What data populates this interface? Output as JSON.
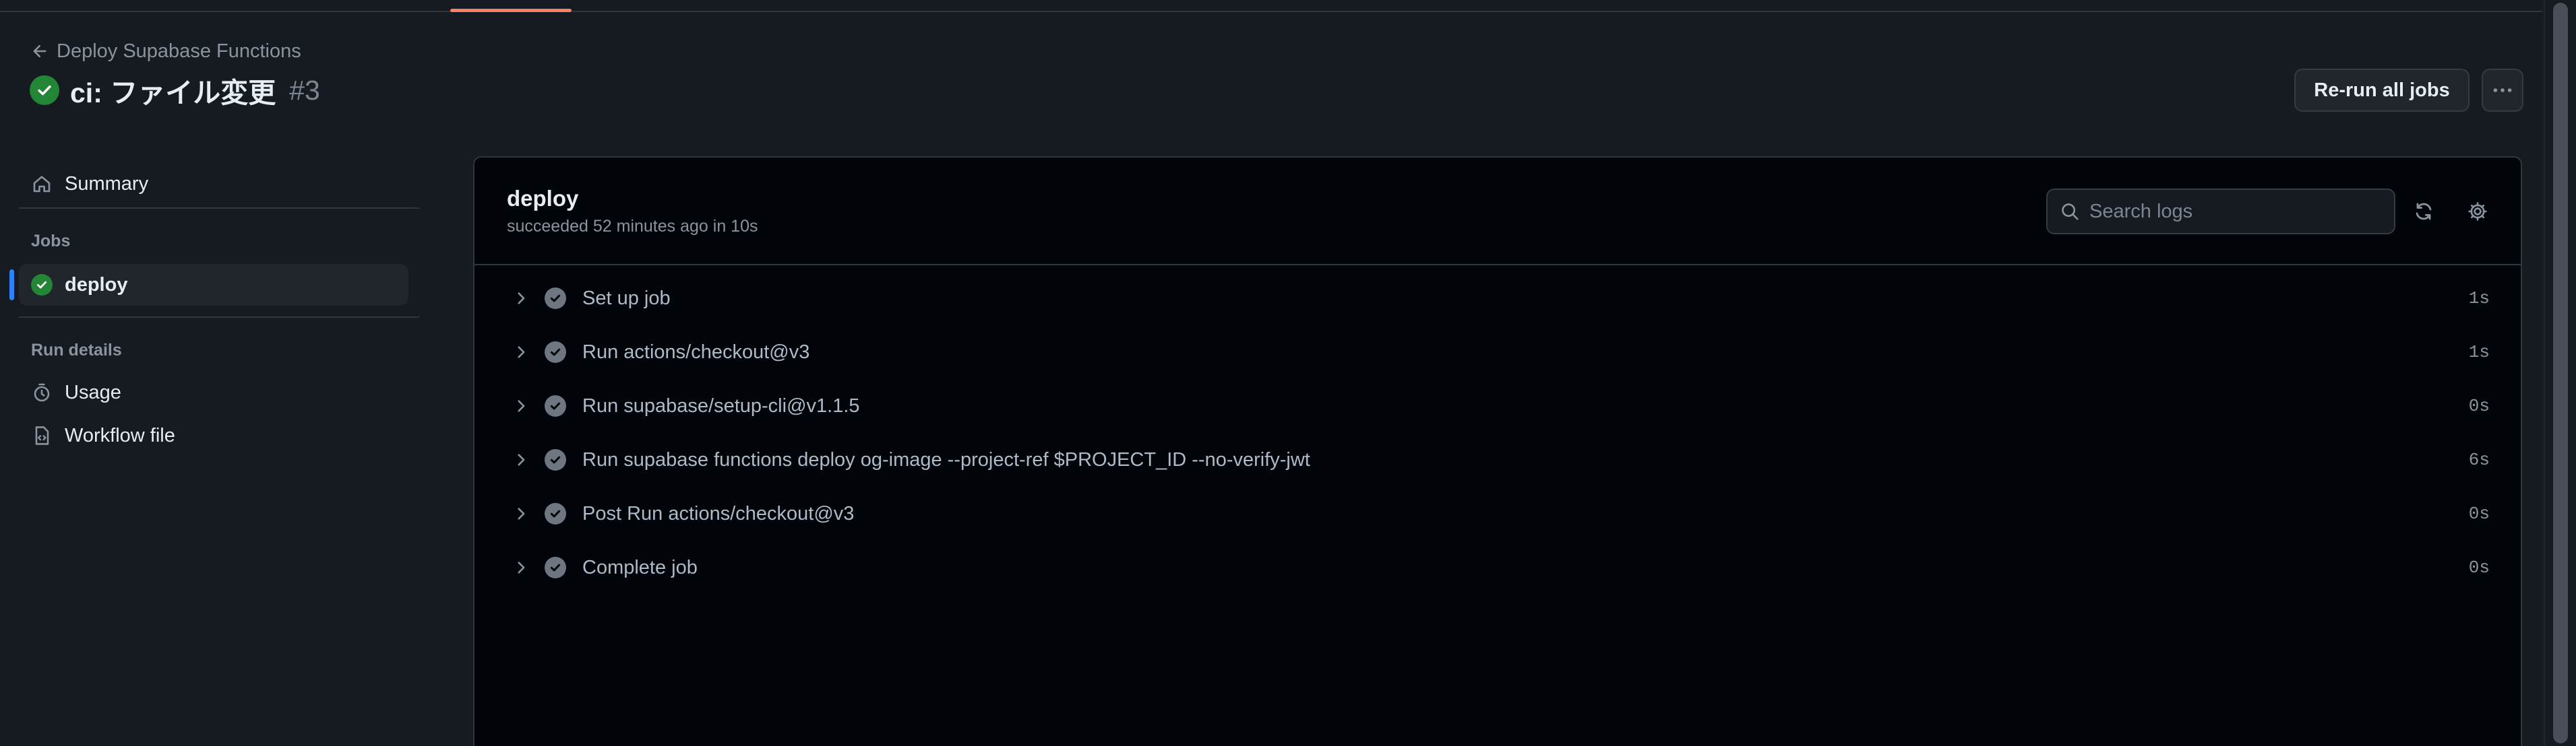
{
  "header": {
    "back_link": "Deploy Supabase Functions",
    "run_title": "ci: ファイル変更",
    "run_number": "#3",
    "rerun_button": "Re-run all jobs"
  },
  "sidebar": {
    "summary": "Summary",
    "jobs_heading": "Jobs",
    "jobs": [
      {
        "label": "deploy",
        "status": "success",
        "active": true
      }
    ],
    "run_details_heading": "Run details",
    "usage": "Usage",
    "workflow_file": "Workflow file"
  },
  "job": {
    "name": "deploy",
    "meta": "succeeded 52 minutes ago in 10s",
    "search_placeholder": "Search logs",
    "steps": [
      {
        "name": "Set up job",
        "duration": "1s"
      },
      {
        "name": "Run actions/checkout@v3",
        "duration": "1s"
      },
      {
        "name": "Run supabase/setup-cli@v1.1.5",
        "duration": "0s"
      },
      {
        "name": "Run supabase functions deploy og-image --project-ref $PROJECT_ID --no-verify-jwt",
        "duration": "6s"
      },
      {
        "name": "Post Run actions/checkout@v3",
        "duration": "0s"
      },
      {
        "name": "Complete job",
        "duration": "0s"
      }
    ]
  },
  "colors": {
    "background": "#161b22",
    "panel": "#010409",
    "success": "#238636",
    "accent_active": "#2f81f7",
    "tab_underline": "#f78166"
  },
  "icons": {
    "back": "arrow-left-icon",
    "success": "check-circle-icon",
    "more": "kebab-horizontal-icon",
    "summary": "home-icon",
    "usage": "stopwatch-icon",
    "workflow_file": "file-code-icon",
    "search": "search-icon",
    "refresh": "sync-icon",
    "settings": "gear-icon",
    "step_expand": "chevron-right-icon"
  }
}
